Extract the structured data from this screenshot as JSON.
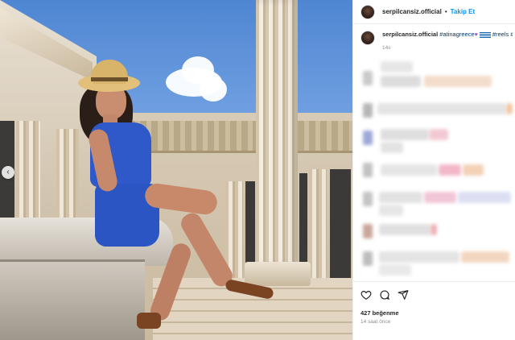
{
  "post": {
    "username": "serpilcansiz.official",
    "follow_label": "Takip Et",
    "separator": "•"
  },
  "caption": {
    "username": "serpilcansiz.official",
    "hashtag1": "#atinagreece",
    "hashtag2": "#reels",
    "hashtag3": "#",
    "time": "14s"
  },
  "engagement": {
    "likes": "427 beğenme",
    "posted_ago": "14 saat önce"
  },
  "icons": {
    "like": "heart-icon",
    "comment": "comment-icon",
    "share": "send-icon",
    "carousel": "chevron-left-icon",
    "emoji_heart": "purple-heart-emoji",
    "emoji_flag": "greece-flag-emoji"
  },
  "colors": {
    "follow": "#0095f6",
    "hashtag": "#00376b",
    "text": "#262626",
    "muted": "#8e8e8e"
  }
}
